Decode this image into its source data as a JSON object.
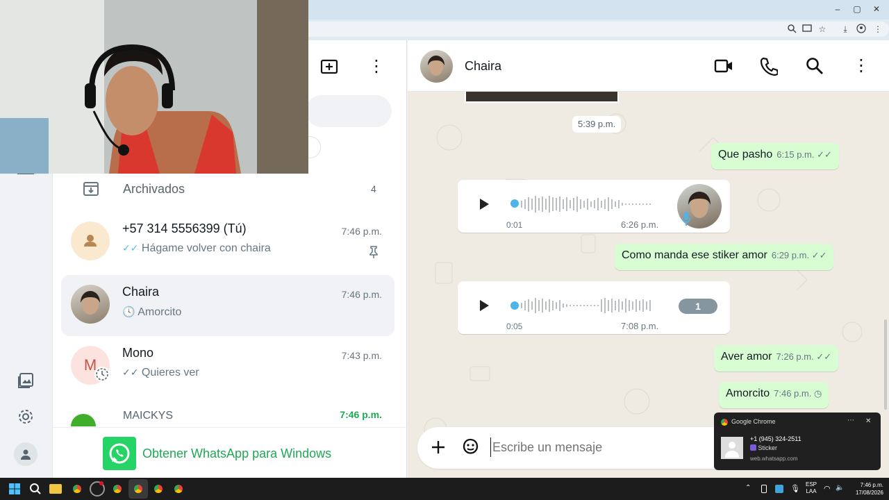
{
  "browser": {
    "window_controls": [
      "–",
      "▢",
      "✕"
    ],
    "toolbar_icons": [
      "zoom-icon",
      "cast-icon",
      "star-icon",
      "download-icon",
      "profile-icon",
      "menu-icon"
    ]
  },
  "sidebar": {
    "archived_label": "Archivados",
    "archived_count": "4",
    "chats": [
      {
        "name": "+57 314 5556399 (Tú)",
        "time": "7:46 p.m.",
        "preview": "Hágame volver con chaira",
        "status": "read",
        "pinned": true
      },
      {
        "name": "Chaira",
        "time": "7:46 p.m.",
        "preview": "Amorcito",
        "status": "pending",
        "selected": true
      },
      {
        "name": "Mono",
        "time": "7:43 p.m.",
        "preview": "Quieres ver",
        "status": "sent",
        "avatar_letter": "M"
      },
      {
        "name": "MAICKYS",
        "time": "7:46 p.m.",
        "time_color": "#1fa855"
      }
    ],
    "promo_label": "Obtener WhatsApp para Windows"
  },
  "chat": {
    "contact_name": "Chaira",
    "date_chip": "5:39 p.m.",
    "messages": [
      {
        "type": "text",
        "text": "Que pasho",
        "time": "6:15 p.m."
      },
      {
        "type": "audio",
        "duration": "0:01",
        "time": "6:26 p.m."
      },
      {
        "type": "text",
        "text": "Como manda ese stiker amor",
        "time": "6:29 p.m."
      },
      {
        "type": "audio",
        "duration": "0:05",
        "time": "7:08 p.m.",
        "badge": "1"
      },
      {
        "type": "text",
        "text": "Aver amor",
        "time": "7:26 p.m."
      },
      {
        "type": "text",
        "text": "Amorcito",
        "time": "7:46 p.m."
      }
    ],
    "input_placeholder": "Escribe un mensaje"
  },
  "notification": {
    "app": "Google Chrome",
    "sender": "+1 (945) 324-2511",
    "body": "Sticker",
    "source": "web.whatsapp.com"
  },
  "taskbar": {
    "lang_line1": "ESP",
    "lang_line2": "LAA",
    "time": "7:46 p.m.",
    "date": "17/08/2026"
  },
  "colors": {
    "accent": "#25d366",
    "bubble_out": "#d9fdd3",
    "read_tick": "#53bdeb",
    "chat_bg": "#efeae2"
  }
}
